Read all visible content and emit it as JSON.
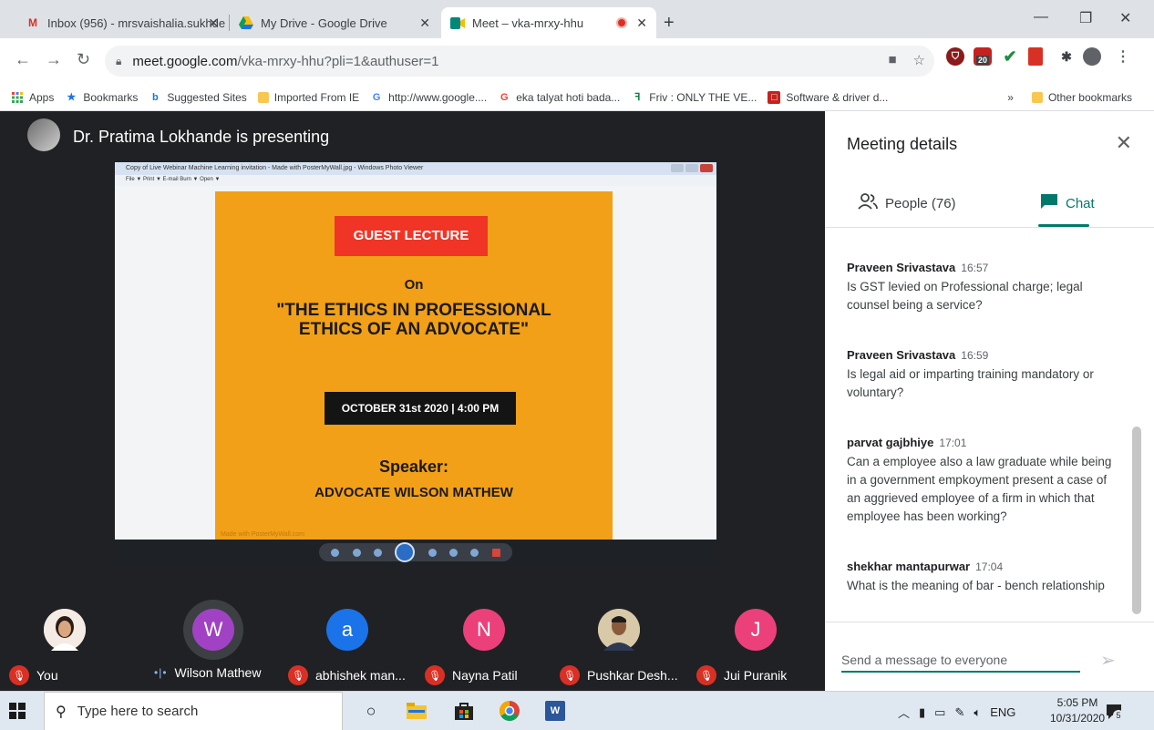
{
  "browser": {
    "tabs": [
      {
        "label": "Inbox (956) - mrsvaishalia.sukhde",
        "icon": "gmail-icon",
        "color": "#d93025"
      },
      {
        "label": "My Drive - Google Drive",
        "icon": "drive-icon",
        "color": "#1a73e8"
      },
      {
        "label": "Meet – vka-mrxy-hhu",
        "icon": "meet-icon",
        "color": "#00897b"
      }
    ],
    "new_tab": "+",
    "url_host": "meet.google.com",
    "url_path": "/vka-mrxy-hhu?pli=1&authuser=1",
    "extension_badge": "20",
    "bookmarks": [
      {
        "label": "Apps",
        "icon": "apps-grid-icon"
      },
      {
        "label": "Bookmarks",
        "icon": "star-icon"
      },
      {
        "label": "Suggested Sites",
        "icon": "bing-icon"
      },
      {
        "label": "Imported From IE",
        "icon": "folder-icon"
      },
      {
        "label": "http://www.google....",
        "icon": "google-icon"
      },
      {
        "label": "eka talyat hoti bada...",
        "icon": "google-icon"
      },
      {
        "label": "Friv : ONLY THE VE...",
        "icon": "friv-icon"
      },
      {
        "label": "Software & driver d...",
        "icon": "lenovo-icon"
      }
    ],
    "more_bookmarks": "»",
    "other_bookmarks": "Other bookmarks"
  },
  "meet": {
    "presenter": "Dr. Pratima Lokhande is presenting",
    "viewer": {
      "title": "Copy of Live Webinar Machine Learning invitation - Made with PosterMyWall.jpg - Windows Photo Viewer",
      "menu": "File ▼   Print ▼   E-mail   Burn ▼   Open ▼"
    },
    "poster": {
      "banner": "GUEST LECTURE",
      "on": "On",
      "topic_line1": "\"THE ETHICS IN PROFESSIONAL",
      "topic_line2": "ETHICS OF AN ADVOCATE\"",
      "date": "OCTOBER 31st 2020 | 4:00 PM",
      "speaker_label": "Speaker:",
      "speaker": "ADVOCATE WILSON MATHEW",
      "watermark": "Made with PosterMyWall.com"
    },
    "participants": [
      {
        "name": "You",
        "initial": "",
        "color": "#e8d9c8",
        "muted": true
      },
      {
        "name": "Wilson Mathew",
        "initial": "W",
        "color": "#a142c4",
        "muted": false
      },
      {
        "name": "abhishek man...",
        "initial": "a",
        "color": "#1a73e8",
        "muted": true
      },
      {
        "name": "Nayna Patil",
        "initial": "N",
        "color": "#ec407a",
        "muted": true
      },
      {
        "name": "Pushkar Desh...",
        "initial": "",
        "color": "#c9b18a",
        "muted": true
      },
      {
        "name": "Jui Puranik",
        "initial": "J",
        "color": "#ec407a",
        "muted": true
      }
    ]
  },
  "panel": {
    "title": "Meeting details",
    "people_tab": "People (76)",
    "chat_tab": "Chat",
    "messages": [
      {
        "sender": "Praveen Srivastava",
        "time": "16:57",
        "text": "Is GST levied on Professional charge; legal counsel being a service?"
      },
      {
        "sender": "Praveen Srivastava",
        "time": "16:59",
        "text": "Is legal aid or imparting training mandatory or voluntary?"
      },
      {
        "sender": "parvat gajbhiye",
        "time": "17:01",
        "text": "Can a employee also a law graduate while being in a government empkoyment present a case of an aggrieved employee of a firm in which that employee has been working?"
      },
      {
        "sender": "shekhar mantapurwar",
        "time": "17:04",
        "text": "What is the meaning of bar - bench relationship"
      }
    ],
    "input_placeholder": "Send a message to everyone"
  },
  "taskbar": {
    "search_placeholder": "Type here to search",
    "lang": "ENG",
    "time": "5:05 PM",
    "date": "10/31/2020",
    "notifications": "5"
  },
  "colors": {
    "accent": "#00796b",
    "poster_bg": "#f2a018",
    "banner_red": "#f03426",
    "muted_red": "#d93025"
  }
}
